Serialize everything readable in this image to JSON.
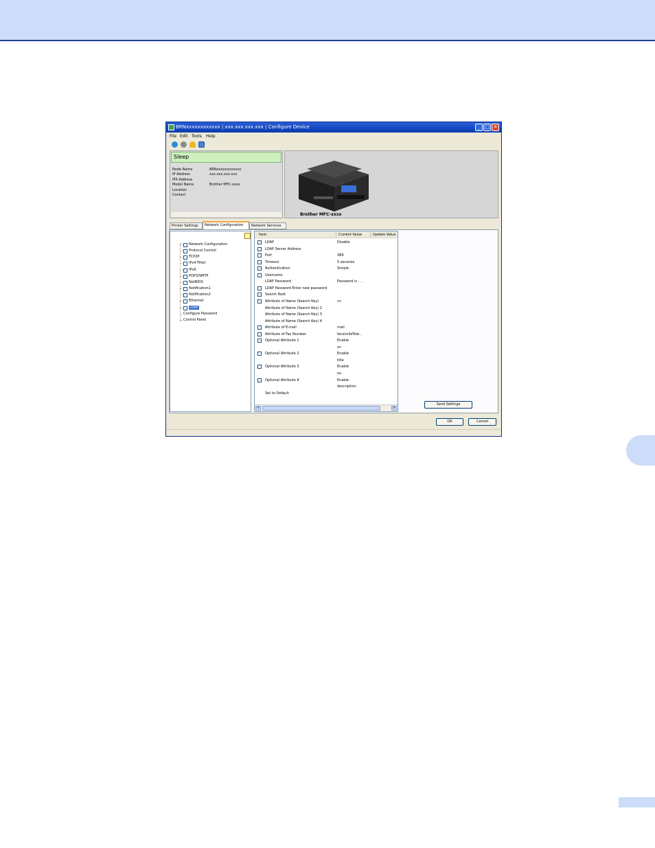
{
  "window": {
    "title": "BRNxxxxxxxxxxxx    | xxx.xxx.xxx.xxx | Configure Device",
    "minimize_icon": "_",
    "restore_icon": "□",
    "close_icon": "✕"
  },
  "menu": [
    "File",
    "Edit",
    "Tools",
    "Help"
  ],
  "toolbar_icons": [
    "refresh-icon",
    "settings-icon",
    "help-bulb-icon",
    "device-icon"
  ],
  "status": {
    "state": "Sleep",
    "fields": [
      {
        "label": "Node Name",
        "value": "BRNxxxxxxxxxxxx"
      },
      {
        "label": "IP Address",
        "value": "xxx.xxx.xxx.xxx"
      },
      {
        "label": "IPX Address",
        "value": ""
      },
      {
        "label": "Model Name",
        "value": "Brother MFC-xxxx"
      },
      {
        "label": "Location",
        "value": ""
      },
      {
        "label": "Contact",
        "value": ""
      }
    ]
  },
  "printer_caption": "Brother MFC-xxxx",
  "tabs": [
    "Printer Settings",
    "Network Configuration",
    "Network Services"
  ],
  "tree": {
    "items": [
      {
        "label": "Network Configuration",
        "checkbox": true
      },
      {
        "label": "Protocol Control",
        "checkbox": true
      },
      {
        "label": "TCP/IP",
        "checkbox": true
      },
      {
        "label": "IPv4 Filter",
        "checkbox": true
      },
      {
        "label": "IPv6",
        "checkbox": true
      },
      {
        "label": "POP3/SMTP",
        "checkbox": true
      },
      {
        "label": "NetBIOS",
        "checkbox": true
      },
      {
        "label": "Notification1",
        "checkbox": true
      },
      {
        "label": "Notification2",
        "checkbox": true
      },
      {
        "label": "Ethernet",
        "checkbox": true
      },
      {
        "label": "LDAP",
        "checkbox": true,
        "selected": true
      },
      {
        "label": "Configure Password",
        "checkbox": false
      },
      {
        "label": "Control Panel",
        "checkbox": false
      }
    ]
  },
  "grid": {
    "columns": [
      "Item",
      "Current Value",
      "Update Value"
    ],
    "rows": [
      {
        "item": "LDAP",
        "value": "Disable",
        "checkbox": true
      },
      {
        "item": "LDAP Server Address",
        "value": "",
        "checkbox": true
      },
      {
        "item": "Port",
        "value": "389",
        "checkbox": true
      },
      {
        "item": "Timeout",
        "value": "5 seconds",
        "checkbox": true
      },
      {
        "item": "Authentication",
        "value": "Simple",
        "checkbox": true
      },
      {
        "item": "Username",
        "value": "",
        "checkbox": true
      },
      {
        "item": "LDAP Password",
        "value": "Password is . . .",
        "checkbox": false
      },
      {
        "item": "LDAP Password Enter new password",
        "value": "",
        "checkbox": true
      },
      {
        "item": "Search Root",
        "value": "",
        "checkbox": true
      },
      {
        "item": "Attribute of Name (Search Key)",
        "value": "cn",
        "checkbox": true
      },
      {
        "item": "Attribute of Name (Search Key) 2",
        "value": "",
        "checkbox": false
      },
      {
        "item": "Attribute of Name (Search Key) 3",
        "value": "",
        "checkbox": false
      },
      {
        "item": "Attribute of Name (Search Key) 4",
        "value": "",
        "checkbox": false
      },
      {
        "item": "Attribute of E-mail",
        "value": "mail",
        "checkbox": true
      },
      {
        "item": "Attribute of Fax Number",
        "value": "facsimileTele...",
        "checkbox": true
      },
      {
        "item": "Optional Attribute 1",
        "value": "Enable",
        "checkbox": true
      },
      {
        "item": "",
        "value": "sn",
        "checkbox": false
      },
      {
        "item": "Optional Attribute 2",
        "value": "Enable",
        "checkbox": true
      },
      {
        "item": "",
        "value": "title",
        "checkbox": false
      },
      {
        "item": "Optional Attribute 3",
        "value": "Enable",
        "checkbox": true
      },
      {
        "item": "",
        "value": "ou",
        "checkbox": false
      },
      {
        "item": "Optional Attribute 4",
        "value": "Enable",
        "checkbox": true
      },
      {
        "item": "",
        "value": "description",
        "checkbox": false
      },
      {
        "item": "Set to Default",
        "value": "",
        "checkbox": false
      }
    ]
  },
  "buttons": {
    "send_settings": "Send Settings",
    "ok": "OK",
    "cancel": "Cancel"
  },
  "scroll": {
    "left": "<",
    "right": ">"
  }
}
